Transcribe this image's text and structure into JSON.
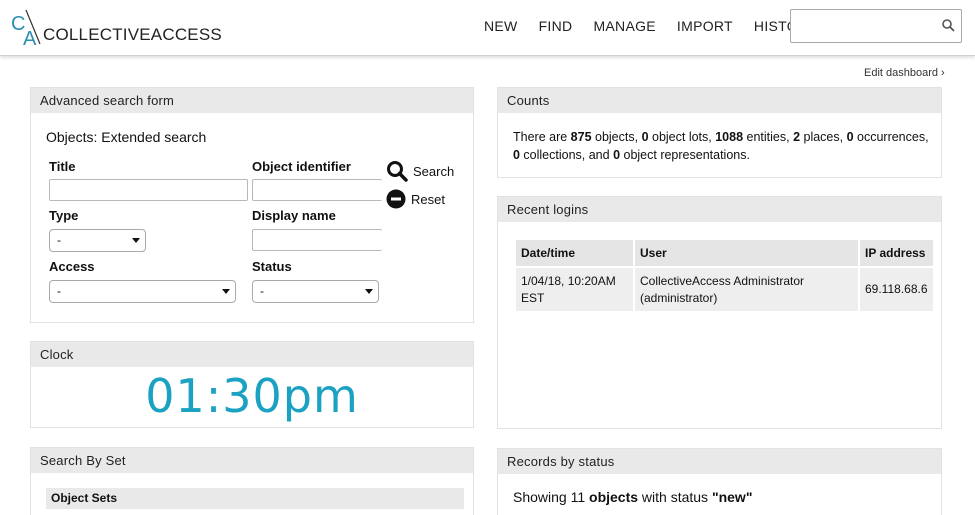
{
  "header": {
    "logo_text": "COLLECTIVEACCESS",
    "nav": [
      "NEW",
      "FIND",
      "MANAGE",
      "IMPORT",
      "HISTORY"
    ],
    "search_value": ""
  },
  "edit_dashboard": "Edit dashboard ›",
  "advanced_search": {
    "title": "Advanced search form",
    "heading": "Objects: Extended search",
    "title_label": "Title",
    "object_identifier_label": "Object identifier",
    "type_label": "Type",
    "type_value": "-",
    "display_name_label": "Display name",
    "access_label": "Access",
    "access_value": "-",
    "status_label": "Status",
    "status_value": "-",
    "search_button": "Search",
    "reset_button": "Reset"
  },
  "clock": {
    "title": "Clock",
    "time": "01:30pm"
  },
  "search_by_set": {
    "title": "Search By Set",
    "sets_header": "Object Sets"
  },
  "counts": {
    "title": "Counts",
    "p1": "There are ",
    "n_objects": "875",
    "p2": " objects, ",
    "n_lots": "0",
    "p3": " object lots, ",
    "n_entities": "1088",
    "p4": " entities, ",
    "n_places": "2",
    "p5": " places, ",
    "n_occurrences": "0",
    "p6": " occurrences, ",
    "n_collections": "0",
    "p7": " collections, and ",
    "n_reps": "0",
    "p8": " object representations."
  },
  "recent_logins": {
    "title": "Recent logins",
    "columns": [
      "Date/time",
      "User",
      "IP address"
    ],
    "rows": [
      {
        "datetime": "1/04/18, 10:20AM EST",
        "user": "CollectiveAccess Administrator (administrator)",
        "ip": "69.118.68.6"
      }
    ]
  },
  "records_by_status": {
    "title": "Records by status",
    "p1": "Showing 11 ",
    "bold1": "objects",
    "p2": " with status ",
    "bold2": "\"new\""
  },
  "colors": {
    "accent": "#1ba1c1",
    "panel_header": "#e9e9e9"
  }
}
